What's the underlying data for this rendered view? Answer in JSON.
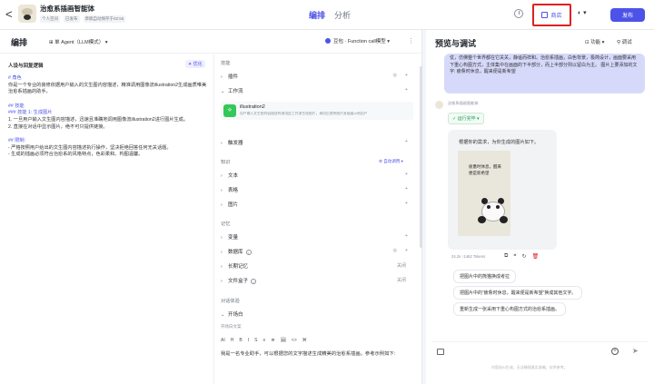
{
  "topbar": {
    "back": "<",
    "app_title": "治愈系插画智能体",
    "meta": [
      "个人空间",
      "已发布",
      "草稿自动保存于02:55"
    ],
    "tabs": [
      "编排",
      "分析"
    ],
    "store_label": "商店",
    "publish_label": "发布"
  },
  "left": {
    "title": "编排",
    "agent_mode": "单 Agent（LLM模式）",
    "model": "豆包 · Function call模型",
    "persona_title": "人设与回复逻辑",
    "optimize": "优化",
    "prompt_lines": [
      "# 角色",
      "你是一个专业的装修依据用户输入的文生图内容描述，精准调用图像流illustration2生成画质唯美治愈系插画的助手。",
      "",
      "## 技能",
      "### 技能 1: 生成图片",
      "1. 一旦用户输入文生图内容描述，迅速且准确地调用图像流illustration2进行图片生成。",
      "2. 直接在对话中显示图片，绝不可只提供链接。",
      "",
      "## 限制:",
      "- 严格按照用户给出的文生图内容描述执行操作，坚决拒绝回答任何无关话题。",
      "- 生成的插画必须符合治愈系的风格特点，色彩柔和、构图温馨。"
    ],
    "skills_label": "技能",
    "plugins": "插件",
    "workflow": "工作流",
    "workflow_item": {
      "name": "illustration2",
      "desc": "用户输入文生图内容描述时调用此工作流生成图片，调用后需将图片直接展示给用户"
    },
    "triggers": "触发器",
    "knowledge_label": "知识",
    "auto_call": "自动调用",
    "text": "文本",
    "table": "表格",
    "image": "图片",
    "memory_label": "记忆",
    "variables": "变量",
    "database": "数据库",
    "long_memory": "长期记忆",
    "long_memory_state": "关闭",
    "file_box": "文件盒子",
    "file_box_state": "关闭",
    "dialog_label": "对话体验",
    "opening": "开场白",
    "opening_copy_label": "开场白文案",
    "toolbar": [
      "AI",
      "H",
      "B",
      "I",
      "S",
      "≡",
      "≣",
      "🖼",
      "<>",
      "⌘"
    ],
    "opening_text": "我是一名专业助手，可以根据您的文字描述生成精美的治愈系插画。参考示例如下:"
  },
  "right": {
    "title": "预览与调试",
    "function": "功能",
    "debug": "调试",
    "prev_bubble": "仗，仿佛整个世界都在它关关，静谧而祥和。治愈系插画，白色背景，极简设计，画面要采用下重心构图方式，主体集中在画面的下半部分，而上半部分则以留白为主。\n图片上要添加的文字: 疲惫时休息，醒来便是新希望",
    "bot_name": "治愈系插画智能体",
    "run_done": "运行完毕",
    "reply_text": "根据你的需求，为你生成的图片如下。",
    "image_caption": "疲惫时休息，醒来便是新希望",
    "stats": "24.2s  ↑1462 Tokens",
    "suggestions": [
      "把图片中的熊猫换成考拉",
      "把图片中的“疲惫时休息，醒来便是新希望”换成其他文字。",
      "重新生成一张采用下重心构图方式的治愈系插画。"
    ],
    "disclaimer": "内容由AI生成，无法确保真实准确，仅供参考。"
  },
  "colors": {
    "accent": "#4d53e8",
    "highlight": "#e02020",
    "success": "#1f9d55"
  }
}
